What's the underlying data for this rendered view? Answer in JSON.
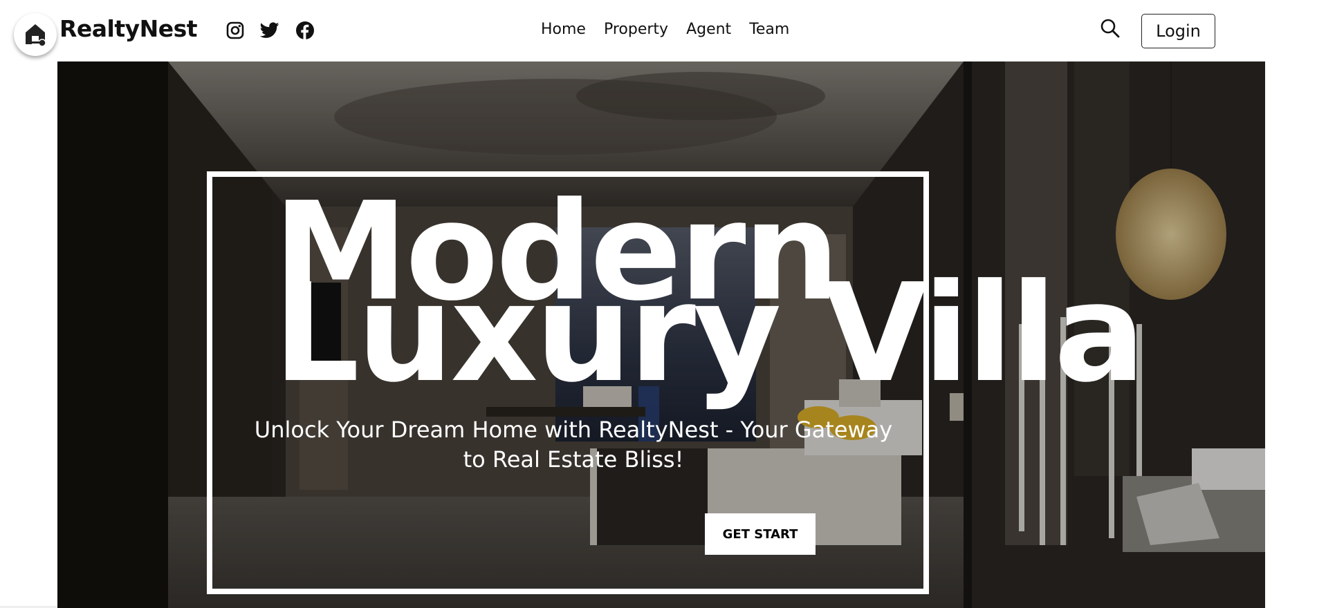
{
  "brand": {
    "name": "RealtyNest"
  },
  "social": [
    {
      "name": "instagram-icon"
    },
    {
      "name": "twitter-icon"
    },
    {
      "name": "facebook-icon"
    }
  ],
  "nav": {
    "items": [
      {
        "label": "Home"
      },
      {
        "label": "Property"
      },
      {
        "label": "Agent"
      },
      {
        "label": "Team"
      }
    ]
  },
  "header": {
    "search_icon": "search-icon",
    "login_label": "Login"
  },
  "hero": {
    "title_line1": "Modern",
    "title_line2": "Luxury Villa",
    "subtitle": "Unlock Your Dream Home with RealtyNest - Your Gateway to Real Estate Bliss!",
    "cta_label": "GET START"
  },
  "colors": {
    "primary_text": "#111111",
    "hero_overlay": "#2a2622",
    "accent_white": "#ffffff",
    "pillow_yellow": "#e8b92a"
  }
}
